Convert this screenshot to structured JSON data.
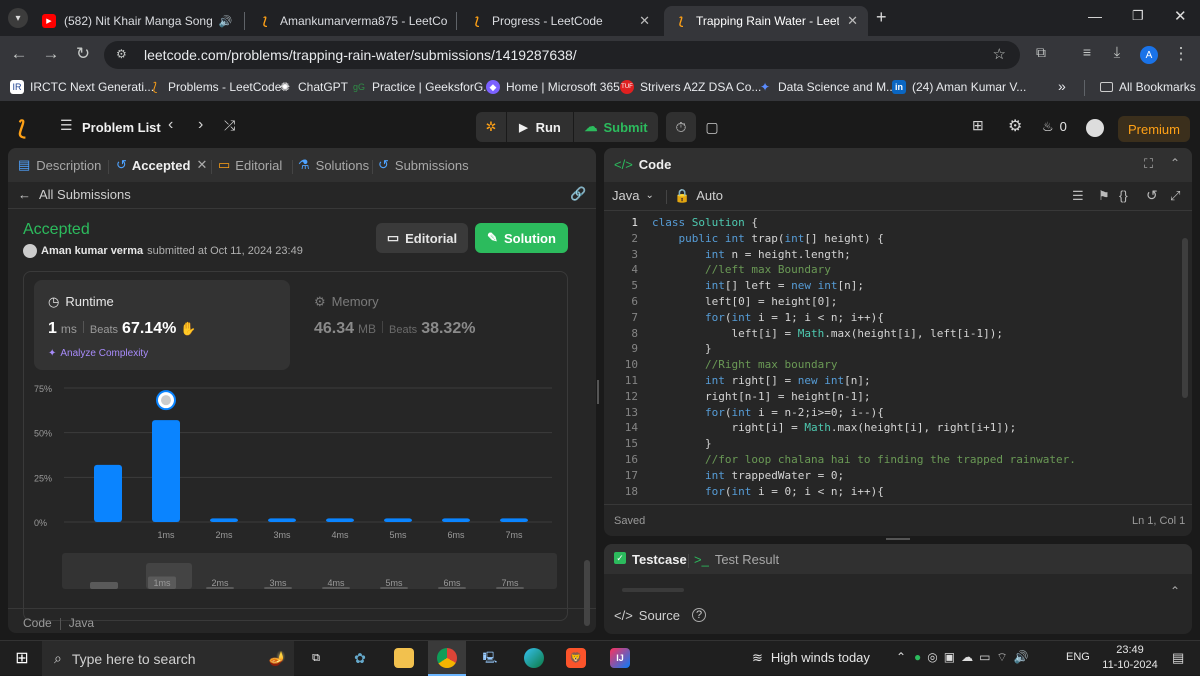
{
  "browser": {
    "tabs": [
      {
        "title": "(582) Nit Khair Manga Song",
        "icon": "youtube-icon"
      },
      {
        "title": "Amankumarverma875 - LeetCo",
        "icon": "leetcode-icon"
      },
      {
        "title": "Progress - LeetCode",
        "icon": "leetcode-icon"
      },
      {
        "title": "Trapping Rain Water - LeetCode",
        "icon": "leetcode-icon",
        "active": true
      }
    ],
    "url": "leetcode.com/problems/trapping-rain-water/submissions/1419287638/",
    "profile_initial": "A",
    "bookmarks": [
      "IRCTC Next Generati...",
      "Problems - LeetCode",
      "ChatGPT",
      "Practice | GeeksforG...",
      "Home | Microsoft 365",
      "Strivers A2Z DSA Co...",
      "Data Science and M...",
      "(24) Aman Kumar V..."
    ],
    "all_bookmarks": "All Bookmarks",
    "bookmarks_more": "»"
  },
  "header": {
    "problem_list": "Problem List",
    "run": "Run",
    "submit": "Submit",
    "streak": "0",
    "premium": "Premium"
  },
  "left": {
    "tabs": {
      "description": "Description",
      "accepted": "Accepted",
      "editorial": "Editorial",
      "solutions": "Solutions",
      "submissions": "Submissions"
    },
    "back": "All Submissions",
    "status": "Accepted",
    "user": "Aman kumar verma",
    "submitted": "submitted at Oct 11, 2024 23:49",
    "editorial_btn": "Editorial",
    "solution_btn": "Solution",
    "runtime": {
      "label": "Runtime",
      "value": "1",
      "unit": "ms",
      "beats_label": "Beats",
      "beats": "67.14%"
    },
    "memory": {
      "label": "Memory",
      "value": "46.34",
      "unit": "MB",
      "beats_label": "Beats",
      "beats": "38.32%"
    },
    "analyze": "Analyze Complexity",
    "footer": {
      "code": "Code",
      "lang": "Java"
    }
  },
  "chart_data": {
    "type": "bar",
    "categories": [
      "",
      "1ms",
      "2ms",
      "3ms",
      "4ms",
      "5ms",
      "6ms",
      "7ms"
    ],
    "values": [
      32,
      57,
      2,
      2,
      2,
      2,
      2,
      2
    ],
    "ylabels": [
      "75%",
      "50%",
      "25%",
      "0%"
    ],
    "ylim": [
      0,
      75
    ],
    "highlight_index": 1,
    "bar_color": "#0a84ff",
    "mini_labels": [
      "1ms",
      "2ms",
      "3ms",
      "4ms",
      "5ms",
      "6ms",
      "7ms"
    ]
  },
  "editor": {
    "title": "Code",
    "language": "Java",
    "mode": "Auto",
    "saved": "Saved",
    "cursor": "Ln 1, Col 1",
    "lines": [
      "class Solution {",
      "    public int trap(int[] height) {",
      "        int n = height.length;",
      "        //left max Boundary",
      "        int[] left = new int[n];",
      "        left[0] = height[0];",
      "        for(int i = 1; i < n; i++){",
      "            left[i] = Math.max(height[i], left[i-1]);",
      "        }",
      "        //Right max boundary",
      "        int right[] = new int[n];",
      "        right[n-1] = height[n-1];",
      "        for(int i = n-2;i>=0; i--){",
      "            right[i] = Math.max(height[i], right[i+1]);",
      "        }",
      "        //for loop chalana hai to finding the trapped rainwater.",
      "        int trappedWater = 0;",
      "        for(int i = 0; i < n; i++){"
    ]
  },
  "testpanel": {
    "testcase": "Testcase",
    "result": "Test Result",
    "source": "Source"
  },
  "taskbar": {
    "search": "Type here to search",
    "weather": "High winds today",
    "lang": "ENG",
    "time": "23:49",
    "date": "11-10-2024"
  }
}
